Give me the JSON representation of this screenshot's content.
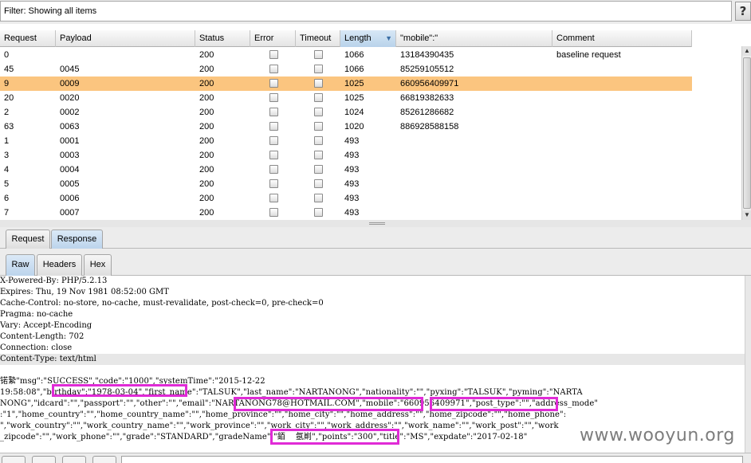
{
  "filter": {
    "text": "Filter: Showing all items",
    "help_label": "?"
  },
  "table": {
    "columns": [
      {
        "label": "Request"
      },
      {
        "label": "Payload"
      },
      {
        "label": "Status"
      },
      {
        "label": "Error"
      },
      {
        "label": "Timeout"
      },
      {
        "label": "Length",
        "sort": "▼"
      },
      {
        "label": "\"mobile\":\""
      },
      {
        "label": "Comment"
      }
    ],
    "rows": [
      {
        "request": "0",
        "payload": "",
        "status": "200",
        "length": "1066",
        "mobile": "13184390435",
        "comment": "baseline request"
      },
      {
        "request": "45",
        "payload": "0045",
        "status": "200",
        "length": "1066",
        "mobile": "85259105512",
        "comment": ""
      },
      {
        "request": "9",
        "payload": "0009",
        "status": "200",
        "length": "1025",
        "mobile": "660956409971",
        "comment": "",
        "selected": true
      },
      {
        "request": "20",
        "payload": "0020",
        "status": "200",
        "length": "1025",
        "mobile": "66819382633",
        "comment": ""
      },
      {
        "request": "2",
        "payload": "0002",
        "status": "200",
        "length": "1024",
        "mobile": "85261286682",
        "comment": ""
      },
      {
        "request": "63",
        "payload": "0063",
        "status": "200",
        "length": "1020",
        "mobile": "886928588158",
        "comment": ""
      },
      {
        "request": "1",
        "payload": "0001",
        "status": "200",
        "length": "493",
        "mobile": "",
        "comment": ""
      },
      {
        "request": "3",
        "payload": "0003",
        "status": "200",
        "length": "493",
        "mobile": "",
        "comment": ""
      },
      {
        "request": "4",
        "payload": "0004",
        "status": "200",
        "length": "493",
        "mobile": "",
        "comment": ""
      },
      {
        "request": "5",
        "payload": "0005",
        "status": "200",
        "length": "493",
        "mobile": "",
        "comment": ""
      },
      {
        "request": "6",
        "payload": "0006",
        "status": "200",
        "length": "493",
        "mobile": "",
        "comment": ""
      },
      {
        "request": "7",
        "payload": "0007",
        "status": "200",
        "length": "493",
        "mobile": "",
        "comment": ""
      }
    ]
  },
  "tabs_main": [
    {
      "label": "Request",
      "active": false
    },
    {
      "label": "Response",
      "active": true
    }
  ],
  "tabs_view": [
    {
      "label": "Raw",
      "active": true
    },
    {
      "label": "Headers",
      "active": false
    },
    {
      "label": "Hex",
      "active": false
    }
  ],
  "response": {
    "headers": [
      "X-Powered-By: PHP/5.2.13",
      "Expires: Thu, 19 Nov 1981 08:52:00 GMT",
      "Cache-Control: no-store, no-cache, must-revalidate, post-check=0, pre-check=0",
      "Pragma: no-cache",
      "Vary: Accept-Encoding",
      "Content-Length: 702",
      "Connection: close",
      "Content-Type: text/html"
    ],
    "body_lines": [
      "锘縶\"msg\":\"SUCCESS\",\"code\":\"1000\",\"systemTime\":\"2015-12-22",
      "19:58:08\",\"birthday\":\"1978-03-04\",\"first_name\":\"TALSUK\",\"last_name\":\"NARTANONG\",\"nationality\":\"\",\"pyxing\":\"TALSUK\",\"pyming\":\"NARTA",
      "NONG\",\"idcard\":\"\",\"passport\":\"\",\"other\":\"\",\"email\":\"NARTANONG78@HOTMAIL.COM\",\"mobile\":\"660956409971\",\"post_type\":\"\",\"address_mode\"",
      ":\"1\",\"home_country\":\"\",\"home_country_name\":\"\",\"home_province\":\"\",\"home_city\":\"\",\"home_address\":\"\",\"home_zipcode\":\"\",\"home_phone\":",
      "\",\"work_country\":\"\",\"work_country_name\":\"\",\"work_province\":\"\",\"work_city\":\"\",\"work_address\":\"\",\"work_name\":\"\",\"work_post\":\"\",\"work",
      "_zipcode\":\"\",\"work_phone\":\"\",\"grade\":\"STANDARD\",\"gradeName\":\"銆    氬崱\",\"points\":\"300\",\"title\":\"MS\",\"expdate\":\"2017-02-18\""
    ]
  },
  "watermark": "www.wooyun.org",
  "colors": {
    "selected_row": "#fbc57f",
    "highlight_box": "#e02bd6",
    "active_tab": "#bcd4ec"
  }
}
